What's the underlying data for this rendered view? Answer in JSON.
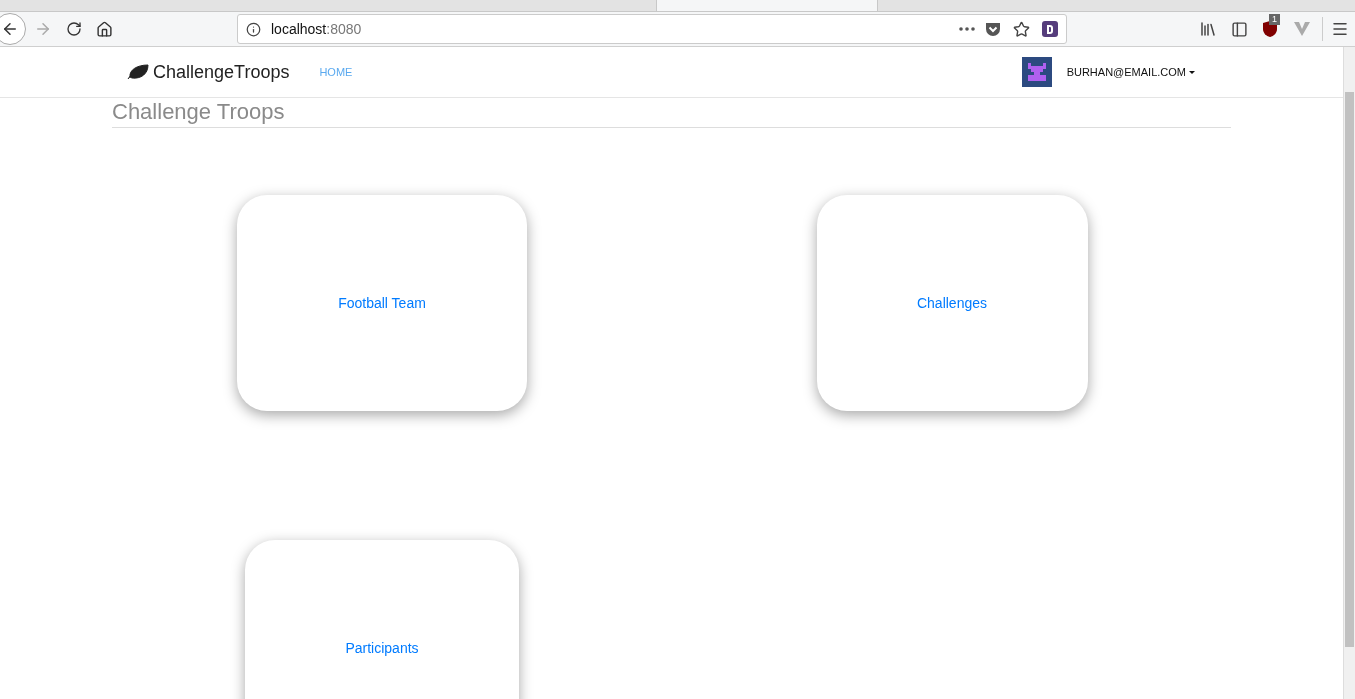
{
  "browser": {
    "url_host": "localhost",
    "url_port": ":8080",
    "blocker_badge": "1"
  },
  "navbar": {
    "brand": "ChallengeTroops",
    "links": [
      {
        "label": "HOME"
      }
    ],
    "user": "BURHAN@EMAIL.COM"
  },
  "heading": "Challenge Troops",
  "cards": [
    {
      "label": "Football Team"
    },
    {
      "label": "Challenges"
    },
    {
      "label": "Participants"
    }
  ]
}
